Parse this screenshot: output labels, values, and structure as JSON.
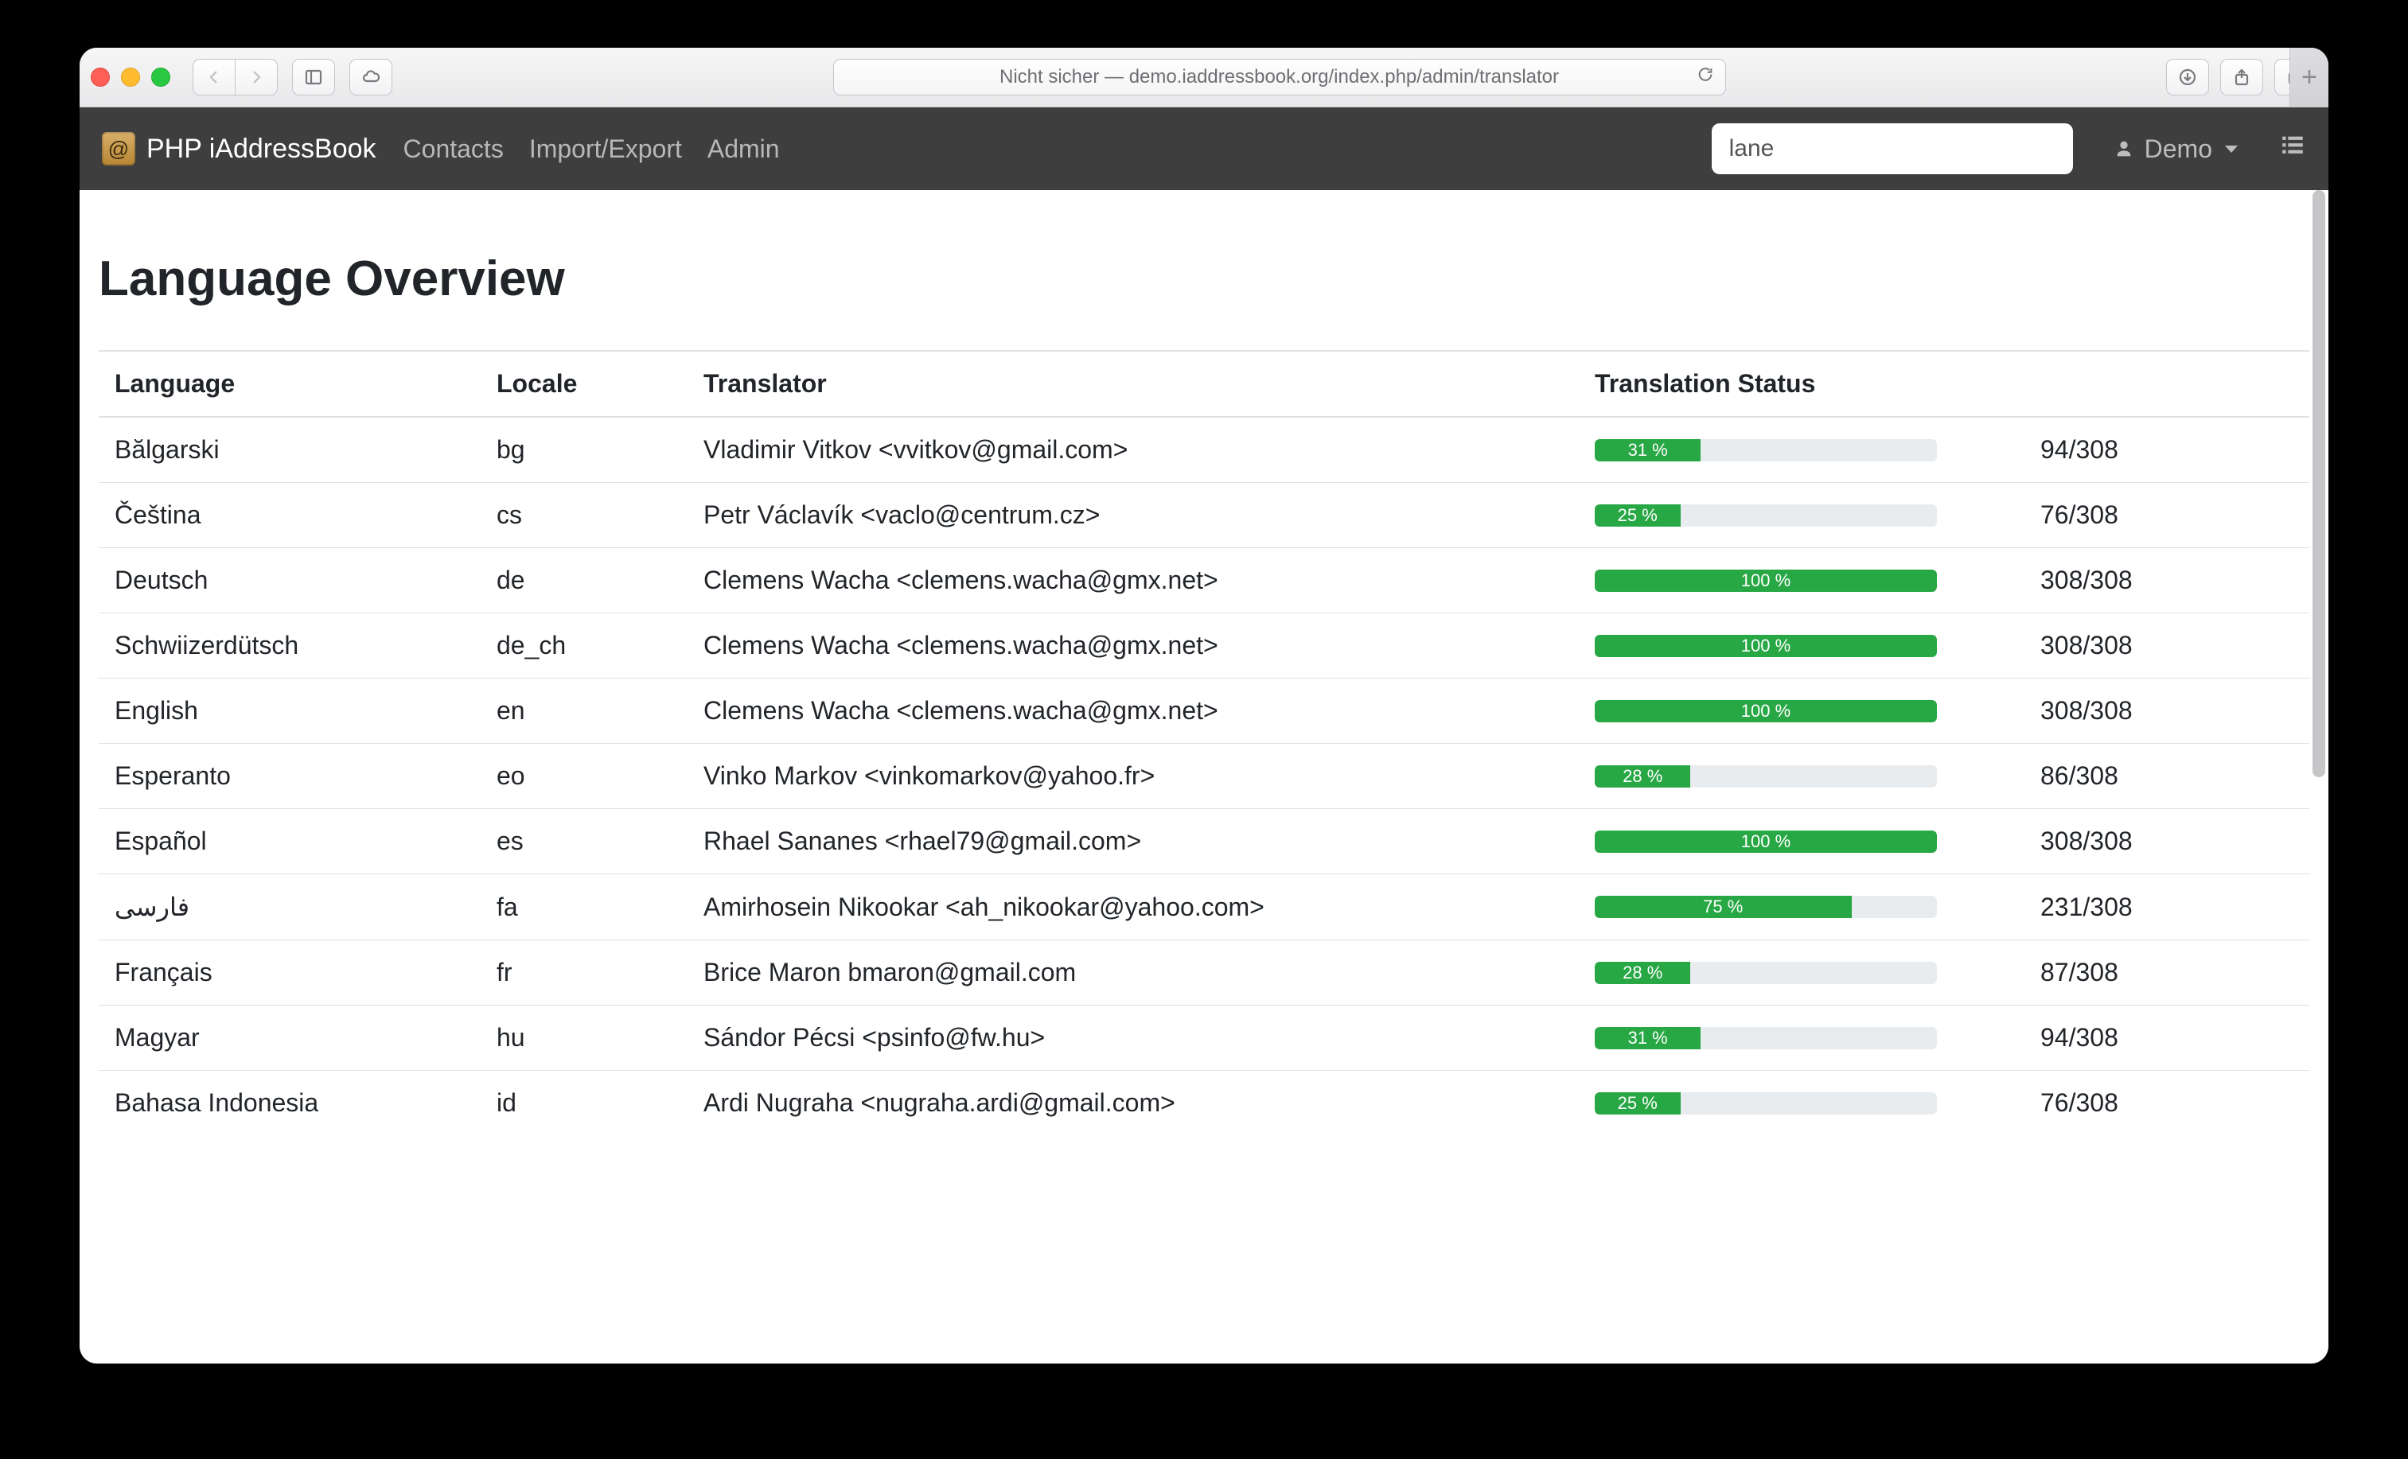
{
  "browser": {
    "address_text": "Nicht sicher — demo.iaddressbook.org/index.php/admin/translator"
  },
  "navbar": {
    "brand": "PHP iAddressBook",
    "links": {
      "contacts": "Contacts",
      "import_export": "Import/Export",
      "admin": "Admin"
    },
    "search_value": "lane",
    "user_label": "Demo"
  },
  "page": {
    "title": "Language Overview",
    "headers": {
      "language": "Language",
      "locale": "Locale",
      "translator": "Translator",
      "status": "Translation Status"
    }
  },
  "rows": [
    {
      "language": "Bălgarski",
      "locale": "bg",
      "translator": "Vladimir Vitkov <vvitkov@gmail.com>",
      "pct": 31,
      "pct_label": "31 %",
      "count": "94/308"
    },
    {
      "language": "Čeština",
      "locale": "cs",
      "translator": "Petr Václavík <vaclo@centrum.cz>",
      "pct": 25,
      "pct_label": "25 %",
      "count": "76/308"
    },
    {
      "language": "Deutsch",
      "locale": "de",
      "translator": "Clemens Wacha <clemens.wacha@gmx.net>",
      "pct": 100,
      "pct_label": "100 %",
      "count": "308/308"
    },
    {
      "language": "Schwiizerdütsch",
      "locale": "de_ch",
      "translator": "Clemens Wacha <clemens.wacha@gmx.net>",
      "pct": 100,
      "pct_label": "100 %",
      "count": "308/308"
    },
    {
      "language": "English",
      "locale": "en",
      "translator": "Clemens Wacha <clemens.wacha@gmx.net>",
      "pct": 100,
      "pct_label": "100 %",
      "count": "308/308"
    },
    {
      "language": "Esperanto",
      "locale": "eo",
      "translator": "Vinko Markov <vinkomarkov@yahoo.fr>",
      "pct": 28,
      "pct_label": "28 %",
      "count": "86/308"
    },
    {
      "language": "Español",
      "locale": "es",
      "translator": "Rhael Sananes <rhael79@gmail.com>",
      "pct": 100,
      "pct_label": "100 %",
      "count": "308/308"
    },
    {
      "language": "فارسی",
      "locale": "fa",
      "translator": "Amirhosein Nikookar <ah_nikookar@yahoo.com>",
      "pct": 75,
      "pct_label": "75 %",
      "count": "231/308"
    },
    {
      "language": "Français",
      "locale": "fr",
      "translator": "Brice Maron bmaron@gmail.com",
      "pct": 28,
      "pct_label": "28 %",
      "count": "87/308"
    },
    {
      "language": "Magyar",
      "locale": "hu",
      "translator": "Sándor Pécsi <psinfo@fw.hu>",
      "pct": 31,
      "pct_label": "31 %",
      "count": "94/308"
    },
    {
      "language": "Bahasa Indonesia",
      "locale": "id",
      "translator": "Ardi Nugraha <nugraha.ardi@gmail.com>",
      "pct": 25,
      "pct_label": "25 %",
      "count": "76/308"
    }
  ]
}
